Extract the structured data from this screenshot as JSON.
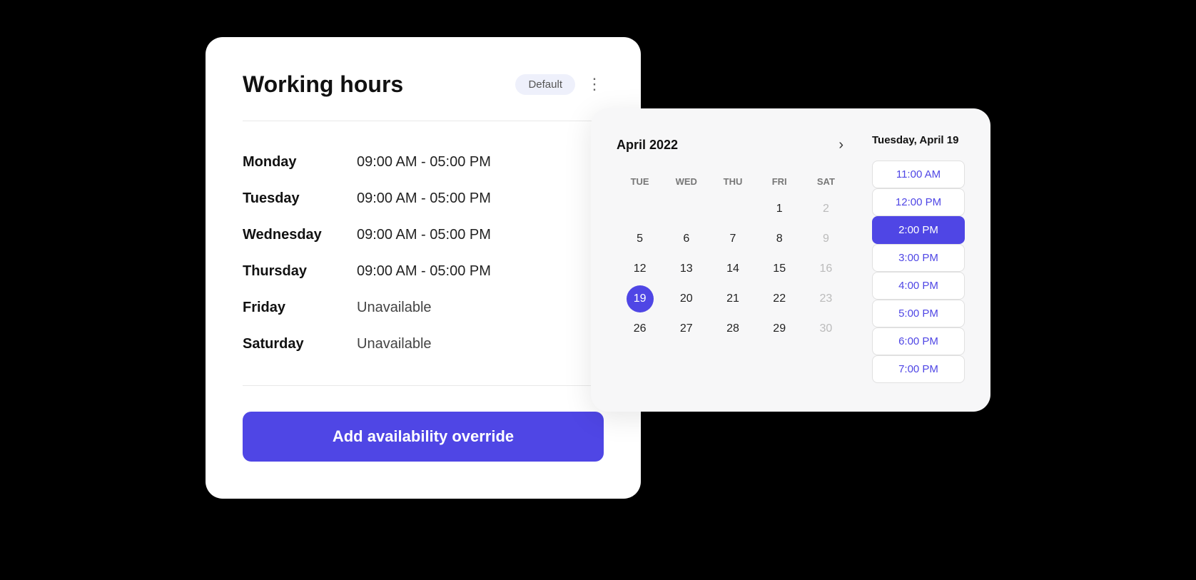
{
  "workingHoursCard": {
    "title": "Working hours",
    "badge": "Default",
    "moreIcon": "⋮",
    "schedule": [
      {
        "day": "Monday",
        "hours": "09:00 AM - 05:00 PM",
        "unavailable": false
      },
      {
        "day": "Tuesday",
        "hours": "09:00 AM - 05:00 PM",
        "unavailable": false
      },
      {
        "day": "Wednesday",
        "hours": "09:00 AM - 05:00 PM",
        "unavailable": false
      },
      {
        "day": "Thursday",
        "hours": "09:00 AM - 05:00 PM",
        "unavailable": false
      },
      {
        "day": "Friday",
        "hours": "Unavailable",
        "unavailable": true
      },
      {
        "day": "Saturday",
        "hours": "Unavailable",
        "unavailable": true
      }
    ],
    "addOverrideButton": "Add availability override"
  },
  "calendarCard": {
    "monthYear": "April 2022",
    "selectedDateLabel": "Tuesday, April 19",
    "weekdays": [
      "TUE",
      "WED",
      "THU",
      "FRI",
      "SAT"
    ],
    "weeks": [
      [
        {
          "day": "",
          "muted": false
        },
        {
          "day": "",
          "muted": false
        },
        {
          "day": "",
          "muted": false
        },
        {
          "day": "1",
          "muted": false
        },
        {
          "day": "2",
          "muted": true
        }
      ],
      [
        {
          "day": "5",
          "muted": false
        },
        {
          "day": "6",
          "muted": false
        },
        {
          "day": "7",
          "muted": false
        },
        {
          "day": "8",
          "muted": false
        },
        {
          "day": "9",
          "muted": true
        }
      ],
      [
        {
          "day": "12",
          "muted": false
        },
        {
          "day": "13",
          "muted": false
        },
        {
          "day": "14",
          "muted": false
        },
        {
          "day": "15",
          "muted": false
        },
        {
          "day": "16",
          "muted": true
        }
      ],
      [
        {
          "day": "19",
          "muted": false,
          "selected": true
        },
        {
          "day": "20",
          "muted": false
        },
        {
          "day": "21",
          "muted": false
        },
        {
          "day": "22",
          "muted": false
        },
        {
          "day": "23",
          "muted": true
        }
      ],
      [
        {
          "day": "26",
          "muted": false
        },
        {
          "day": "27",
          "muted": false
        },
        {
          "day": "28",
          "muted": false
        },
        {
          "day": "29",
          "muted": false
        },
        {
          "day": "30",
          "muted": true
        }
      ]
    ],
    "timeSlots": [
      {
        "time": "11:00 AM",
        "active": false
      },
      {
        "time": "12:00 PM",
        "active": false
      },
      {
        "time": "2:00 PM",
        "active": true
      },
      {
        "time": "3:00 PM",
        "active": false
      },
      {
        "time": "4:00 PM",
        "active": false
      },
      {
        "time": "5:00 PM",
        "active": false
      },
      {
        "time": "6:00 PM",
        "active": false
      },
      {
        "time": "7:00 PM",
        "active": false
      }
    ]
  }
}
